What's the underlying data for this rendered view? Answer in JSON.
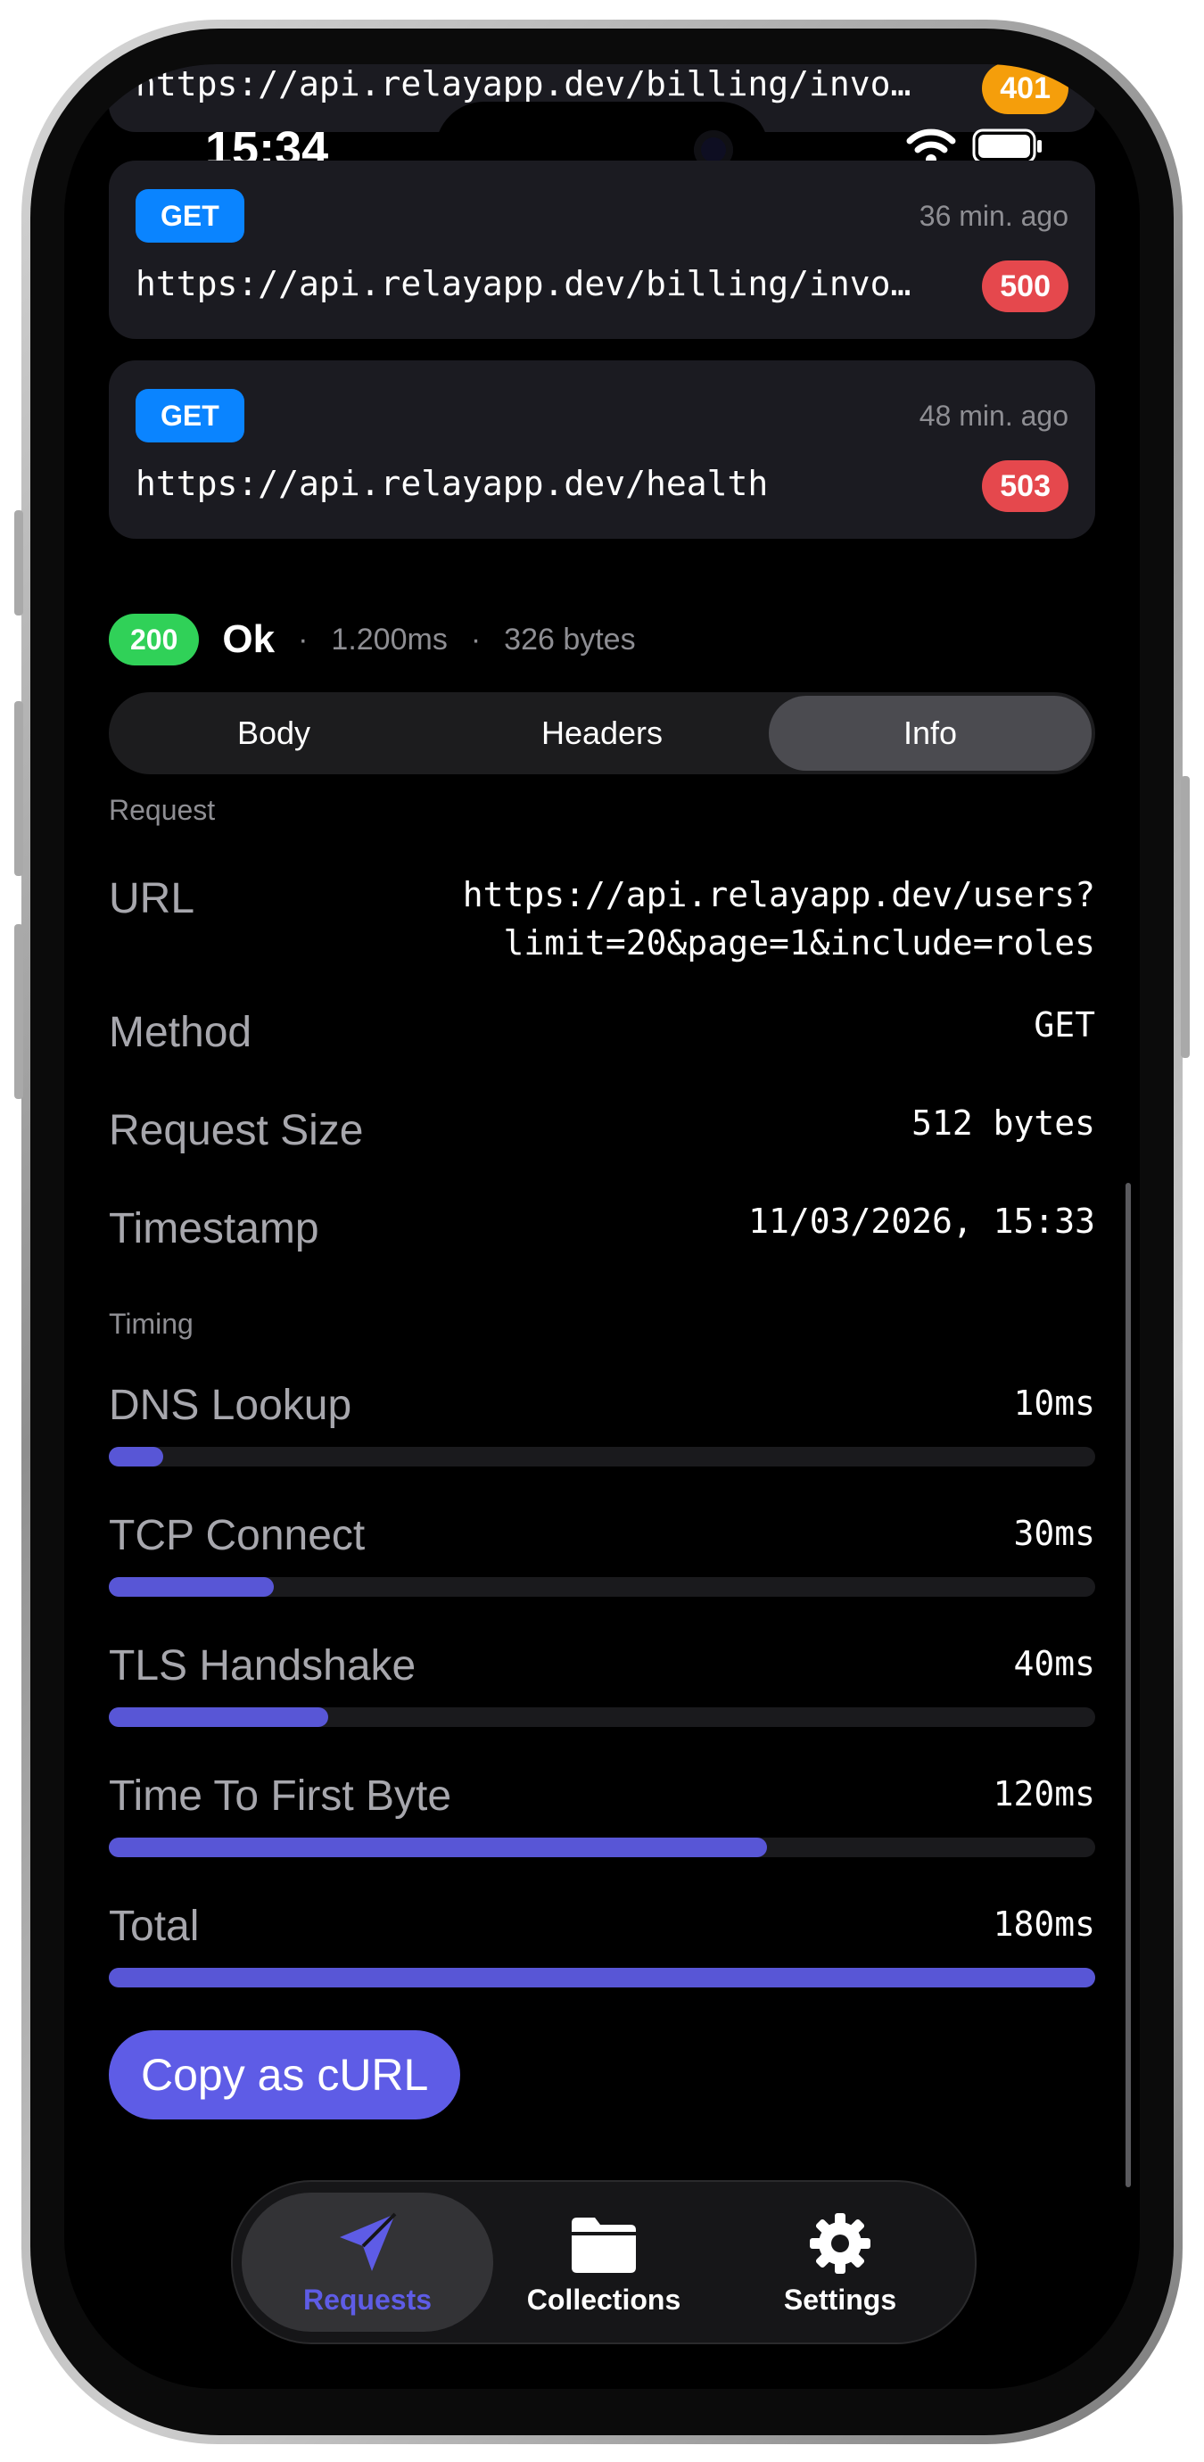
{
  "status_bar": {
    "time": "15:34"
  },
  "history": [
    {
      "method": "",
      "ago": "",
      "url": "https://api.relayapp.dev/billing/invo…",
      "code": "401",
      "code_color": "#f59e0b"
    },
    {
      "method": "GET",
      "ago": "36 min. ago",
      "url": "https://api.relayapp.dev/billing/invoices",
      "code": "500",
      "code_color": "#e5484d"
    },
    {
      "method": "GET",
      "ago": "48 min. ago",
      "url": "https://api.relayapp.dev/health",
      "code": "503",
      "code_color": "#e5484d"
    }
  ],
  "response": {
    "code": "200",
    "text": "Ok",
    "sep": "·",
    "duration": "1.200ms",
    "size": "326 bytes"
  },
  "tabs": {
    "body": "Body",
    "headers": "Headers",
    "info": "Info",
    "active": "Info"
  },
  "request_section": {
    "title": "Request",
    "url_label": "URL",
    "url_value_line1": "https://api.relayapp.dev/users?",
    "url_value_line2": "limit=20&page=1&include=roles",
    "method_label": "Method",
    "method_value": "GET",
    "size_label": "Request Size",
    "size_value": "512 bytes",
    "timestamp_label": "Timestamp",
    "timestamp_value": "11/03/2026, 15:33"
  },
  "timing_section": {
    "title": "Timing",
    "rows": [
      {
        "label": "DNS Lookup",
        "value": "10ms",
        "fraction": 0.055
      },
      {
        "label": "TCP Connect",
        "value": "30ms",
        "fraction": 0.167
      },
      {
        "label": "TLS Handshake",
        "value": "40ms",
        "fraction": 0.222
      },
      {
        "label": "Time To First Byte",
        "value": "120ms",
        "fraction": 0.667
      },
      {
        "label": "Total",
        "value": "180ms",
        "fraction": 1.0
      }
    ]
  },
  "copy_button": "Copy as cURL",
  "tabbar": {
    "requests": "Requests",
    "collections": "Collections",
    "settings": "Settings",
    "active_color": "#5e5ce6"
  },
  "colors": {
    "accent": "#5e5ce6",
    "bar": "#5856d6",
    "success": "#30d158",
    "error": "#e5484d",
    "get": "#0a84ff"
  }
}
